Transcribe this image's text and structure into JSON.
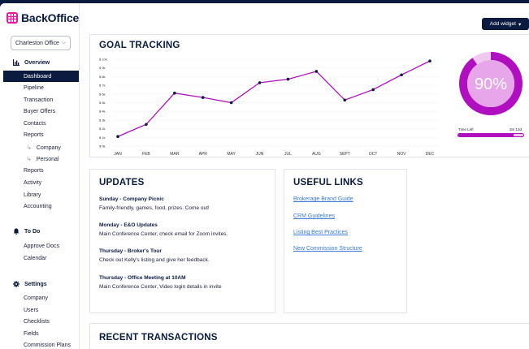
{
  "app": {
    "name": "BackOffice"
  },
  "office_select": {
    "value": "Charleston Office"
  },
  "sidebar": {
    "overview": {
      "label": "Overview"
    },
    "overview_items": [
      "Dashboard",
      "Pipeline",
      "Transaction",
      "Buyer Offers",
      "Contacts",
      "Reports"
    ],
    "reports_sub": [
      "Company",
      "Personal"
    ],
    "overview_items_2": [
      "Reports",
      "Activity",
      "Library",
      "Accounting"
    ],
    "todo": {
      "label": "To Do"
    },
    "todo_items": [
      "Approve Docs",
      "Calendar"
    ],
    "settings": {
      "label": "Settings"
    },
    "settings_items": [
      "Company",
      "Users",
      "Checklists",
      "Fields",
      "Commission Plans"
    ]
  },
  "toolbar": {
    "add_widget_label": "Add widget"
  },
  "goal_tracking": {
    "title": "GOAL TRACKING",
    "gauge_value": "90%",
    "gauge_fraction": 0.9,
    "time_left_label": "Time Left",
    "time_left_value": "3m 13d",
    "time_fraction": 0.85
  },
  "chart_data": {
    "type": "line",
    "categories": [
      "JAN",
      "FEB",
      "MAR",
      "APR",
      "MAY",
      "JUN",
      "JUL",
      "AUG",
      "SEPT",
      "OCT",
      "NOV",
      "DEC"
    ],
    "values": [
      1100,
      2500,
      6100,
      5600,
      5000,
      7300,
      7700,
      8600,
      5300,
      6500,
      8200,
      9800
    ],
    "yticks": [
      "$ 0k",
      "$ 1k",
      "$ 2k",
      "$ 3k",
      "$ 4k",
      "$ 5k",
      "$ 6k",
      "$ 7k",
      "$ 8k",
      "$ 9k",
      "$ 10k"
    ],
    "ylim": [
      0,
      10000
    ],
    "color": "#b00fc0"
  },
  "updates": {
    "title": "UPDATES",
    "items": [
      {
        "heading": "Sunday - Company Picnic",
        "body": "Family-friendly, games, food, prizes. Come out!"
      },
      {
        "heading": "Monday - E&O Updates",
        "body": "Main Conference Center, check email for Zoom invites."
      },
      {
        "heading": "Thursday - Broker's Tour",
        "body": "Check out Kelly's listing and give her feedback."
      },
      {
        "heading": "Thursday - Office Meeting at 10AM",
        "body": "Main Conference Center, Video login details in invite"
      }
    ]
  },
  "useful_links": {
    "title": "USEFUL LINKS",
    "items": [
      "Brokerage Brand Guide",
      "CRM Guidelines",
      "Listing Best Practices",
      "New Commission Structure"
    ]
  },
  "recent": {
    "title": "RECENT TRANSACTIONS"
  },
  "colors": {
    "navy": "#0b1b3f",
    "accent": "#b00fc0",
    "brand": "#e7189b",
    "link": "#3a7ad8"
  }
}
